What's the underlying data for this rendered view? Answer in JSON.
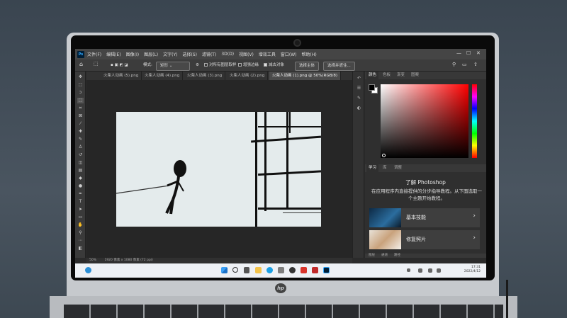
{
  "menubar": {
    "app_badge": "Ps",
    "items": [
      "文件(F)",
      "编辑(E)",
      "图像(I)",
      "图层(L)",
      "文字(Y)",
      "选择(S)",
      "滤镜(T)",
      "3D(D)",
      "视图(V)",
      "增效工具",
      "窗口(W)",
      "帮助(H)"
    ],
    "minimize": "—",
    "maximize": "☐",
    "close": "✕"
  },
  "options": {
    "mode_label": "模式:",
    "mode_value": "矩形",
    "align_edges": "对所有图层取样",
    "enhance_edges": "增强边缘",
    "subtract_object": "减去对象",
    "select_subject": "选择主体",
    "select_and_mask": "选择并遮住..."
  },
  "tabs": [
    "火柴人动画 (5).png",
    "火柴人动画 (4).png",
    "火柴人动画 (3).png",
    "火柴人动画 (2).png",
    "火柴人动画 (1).png @ 50%(RGB/8)"
  ],
  "tabs_overflow": "»",
  "status": {
    "zoom": "50%",
    "doc_info": "1920 像素 x 1080 像素 (72 ppi)"
  },
  "color_panel": {
    "tabs": [
      "颜色",
      "色板",
      "渐变",
      "图案"
    ]
  },
  "learn_panel": {
    "tabs": [
      "学习",
      "库",
      "调整"
    ],
    "title": "了解 Photoshop",
    "description": "在应用程序内直接提供的分步指导教程。从下面选取一个主题开始教程。",
    "cards": [
      {
        "label": "基本技能"
      },
      {
        "label": "修复照片"
      }
    ]
  },
  "bottom_tabs": [
    "图层",
    "通道",
    "路径"
  ],
  "taskbar": {
    "time": "17:31",
    "date": "2022/4/12"
  },
  "laptop": {
    "brand": "hp"
  },
  "colors": {
    "accent_red": "#ff0000",
    "ps_blue": "#31a8ff",
    "artboard_bg": "#e4ebec"
  }
}
